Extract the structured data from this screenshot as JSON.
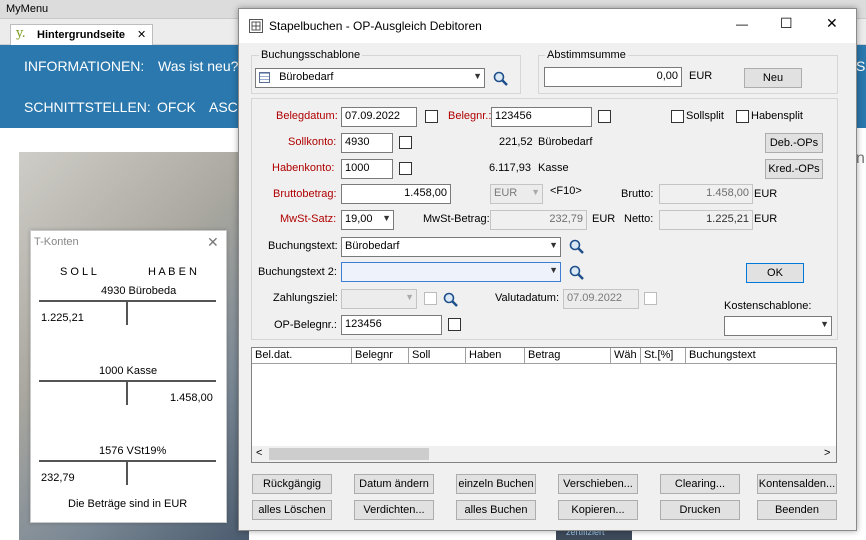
{
  "background_app": {
    "menu_title": "MyMenu",
    "tab_label": "Hintergrundseite",
    "tab_close": "✕",
    "nav_row1": [
      "INFORMATIONEN:",
      "Was ist neu?"
    ],
    "nav_row2": [
      "SCHNITTSTELLEN:",
      "OFCK",
      "ASC"
    ],
    "edge_text": "SC",
    "edge_text2": "n:",
    "badge_text": "zertifiziert"
  },
  "t_konten": {
    "title": "T-Konten",
    "close": "✕",
    "soll": "S O L L",
    "haben": "H A B E N",
    "accounts": [
      {
        "header": "4930  Bürobeda",
        "left": "1.225,21",
        "right": ""
      },
      {
        "header": "1000  Kasse",
        "left": "",
        "right": "1.458,00"
      },
      {
        "header": "1576  VSt19%",
        "left": "232,79",
        "right": ""
      }
    ],
    "footer": "Die Beträge sind in  EUR"
  },
  "window": {
    "title": "Stapelbuchen - OP-Ausgleich Debitoren",
    "controls": {
      "minimize": "—",
      "maximize": "☐",
      "close": "✕"
    },
    "template": {
      "label": "Buchungsschablone",
      "value": "Bürobedarf"
    },
    "checksum": {
      "label": "Abstimmsumme",
      "value": "0,00",
      "currency": "EUR",
      "new_button": "Neu"
    },
    "fields": {
      "belegdatum_label": "Belegdatum:",
      "belegdatum": "07.09.2022",
      "belegnr_label": "Belegnr.:",
      "belegnr": "123456",
      "sollsplit": "Sollsplit",
      "habensplit": "Habensplit",
      "sollkonto_label": "Sollkonto:",
      "sollkonto": "4930",
      "soll_balance": "221,52",
      "soll_name": "Bürobedarf",
      "deb_ops": "Deb.-OPs",
      "habenkonto_label": "Habenkonto:",
      "habenkonto": "1000",
      "haben_balance": "6.117,93",
      "haben_name": "Kasse",
      "kred_ops": "Kred.-OPs",
      "brutto_label": "Bruttobetrag:",
      "brutto": "1.458,00",
      "currency": "EUR",
      "f10": "<F10>",
      "brutto_sum_label": "Brutto:",
      "brutto_sum": "1.458,00",
      "brutto_sum_cur": "EUR",
      "mwst_label": "MwSt-Satz:",
      "mwst": "19,00",
      "mwst_betrag_label": "MwSt-Betrag:",
      "mwst_betrag": "232,79",
      "mwst_betrag_cur": "EUR",
      "netto_label": "Netto:",
      "netto": "1.225,21",
      "netto_cur": "EUR",
      "buchungstext_label": "Buchungstext:",
      "buchungstext": "Bürobedarf",
      "buchungstext2_label": "Buchungstext 2:",
      "buchungstext2": "",
      "ok_button": "OK",
      "zahlungsziel_label": "Zahlungsziel:",
      "valutadatum_label": "Valutadatum:",
      "valutadatum": "07.09.2022",
      "kostenschablone_label": "Kostenschablone:",
      "op_belegnr_label": "OP-Belegnr.:",
      "op_belegnr": "123456"
    },
    "grid_columns": [
      "Bel.dat.",
      "Belegnr",
      "Soll",
      "Haben",
      "Betrag",
      "Wäh",
      "St.[%]",
      "Buchungstext"
    ],
    "scroll_left": "<",
    "scroll_right": ">",
    "buttons_row1": [
      "Rückgängig",
      "Datum ändern",
      "einzeln Buchen",
      "Verschieben...",
      "Clearing...",
      "Kontensalden..."
    ],
    "buttons_row2": [
      "alles Löschen",
      "Verdichten...",
      "alles Buchen",
      "Kopieren...",
      "Drucken",
      "Beenden"
    ]
  }
}
